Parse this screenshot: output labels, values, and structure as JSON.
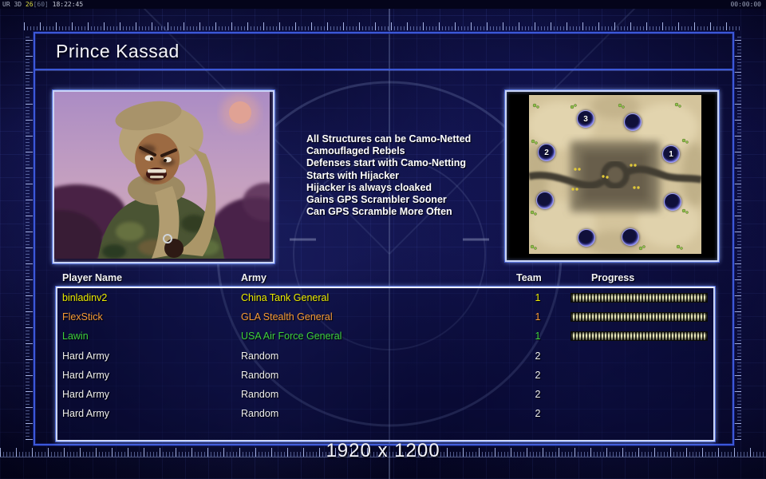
{
  "hud": {
    "debug": {
      "renderer": "UR 3D",
      "fps": "26",
      "fps_cap": "[60]",
      "clock": "18:22:45"
    },
    "timer": "00:00:00",
    "resolution": "1920 x 1200"
  },
  "general": {
    "title": "Prince Kassad",
    "abilities": [
      "All Structures can be Camo-Netted",
      "Camouflaged Rebels",
      "Defenses start with Camo-Netting",
      "Starts with Hijacker",
      "Hijacker is always cloaked",
      "Gains GPS Scrambler Sooner",
      "Can GPS Scramble More Often"
    ]
  },
  "map_preview": {
    "start_labels": {
      "pos1": "1",
      "pos2": "2",
      "pos3": "3"
    }
  },
  "players": {
    "headers": {
      "name": "Player Name",
      "army": "Army",
      "team": "Team",
      "progress": "Progress"
    },
    "rows": [
      {
        "name": "binladinv2",
        "army": "China Tank General",
        "team": "1",
        "color": "#ededed00",
        "text_color": "#ecec00",
        "progress": 100
      },
      {
        "name": "FlexStick",
        "army": "GLA Stealth General",
        "team": "1",
        "color": "#f79b38",
        "text_color": "#f79b38",
        "progress": 100
      },
      {
        "name": "Lawin",
        "army": "USA Air Force General",
        "team": "1",
        "color": "#3ed13e",
        "text_color": "#3ed13e",
        "progress": 100
      },
      {
        "name": "Hard Army",
        "army": "Random",
        "team": "2",
        "color": "#efefef",
        "text_color": "#efefef",
        "progress": null
      },
      {
        "name": "Hard Army",
        "army": "Random",
        "team": "2",
        "color": "#efefef",
        "text_color": "#efefef",
        "progress": null
      },
      {
        "name": "Hard Army",
        "army": "Random",
        "team": "2",
        "color": "#efefef",
        "text_color": "#efefef",
        "progress": null
      },
      {
        "name": "Hard Army",
        "army": "Random",
        "team": "2",
        "color": "#efefef",
        "text_color": "#efefef",
        "progress": null
      }
    ]
  },
  "colors": {
    "panel_border": "#3c58d8",
    "glow_border": "#c9d4f6",
    "background": "#10104a",
    "progress_stripe": "#e2e2b4"
  }
}
